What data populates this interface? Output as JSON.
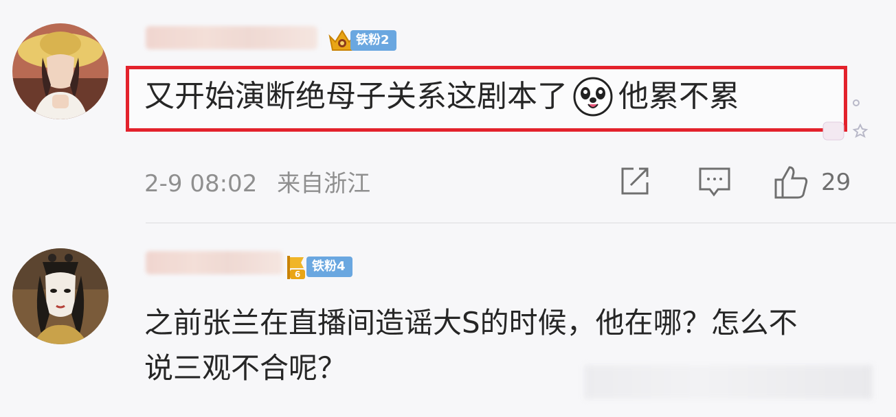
{
  "comments": [
    {
      "badge": "铁粉2",
      "text_before_emoji": "又开始演断绝母子关系这剧本了",
      "text_after_emoji": "他累不累",
      "emoji_icon": "laughing-dog-emoji-icon",
      "timestamp": "2-9 08:02",
      "location": "来自浙江",
      "like_count": "29",
      "highlight_color": "#e3222c"
    },
    {
      "badge": "铁粉4",
      "badge_level": "6",
      "text": "之前张兰在直播间造谣大S的时候，他在哪？怎么不说三观不合呢？"
    }
  ],
  "colors": {
    "badge_blue": "#6aa7e0",
    "text": "#262626",
    "meta": "#8f8f8f"
  }
}
